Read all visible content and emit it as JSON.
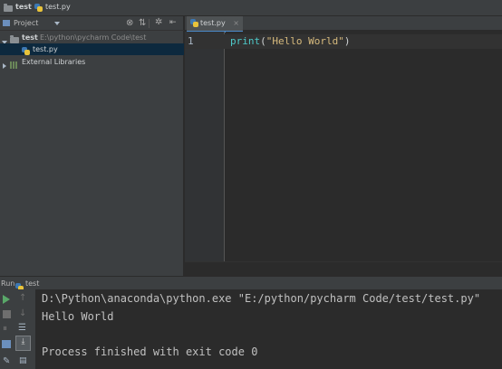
{
  "navbar": {
    "project": "test",
    "file": "test.py"
  },
  "project_panel": {
    "header_label": "Project",
    "tree": [
      {
        "name": "test",
        "path": "E:\\python\\pycharm Code\\test"
      },
      {
        "name": "test.py"
      },
      {
        "name": "External Libraries"
      }
    ]
  },
  "editor": {
    "tab_label": "test.py",
    "lines": [
      {
        "number": "1",
        "func": "print",
        "open": "(",
        "string": "\"Hello World\"",
        "close": ")"
      }
    ]
  },
  "run": {
    "label": "Run",
    "config": "test",
    "console": [
      "D:\\Python\\anaconda\\python.exe \"E:/python/pycharm Code/test/test.py\"",
      "Hello World",
      "",
      "Process finished with exit code 0"
    ]
  },
  "colors": {
    "keyword": "#4ec9c9",
    "string": "#d7ba7d",
    "selection": "#0d293e",
    "run_green": "#59a869"
  },
  "icons": [
    "folder-icon",
    "python-file-icon",
    "settings-icon",
    "collapse-icon",
    "run-icon",
    "stop-icon",
    "rerun-icon",
    "scroll-icon"
  ]
}
